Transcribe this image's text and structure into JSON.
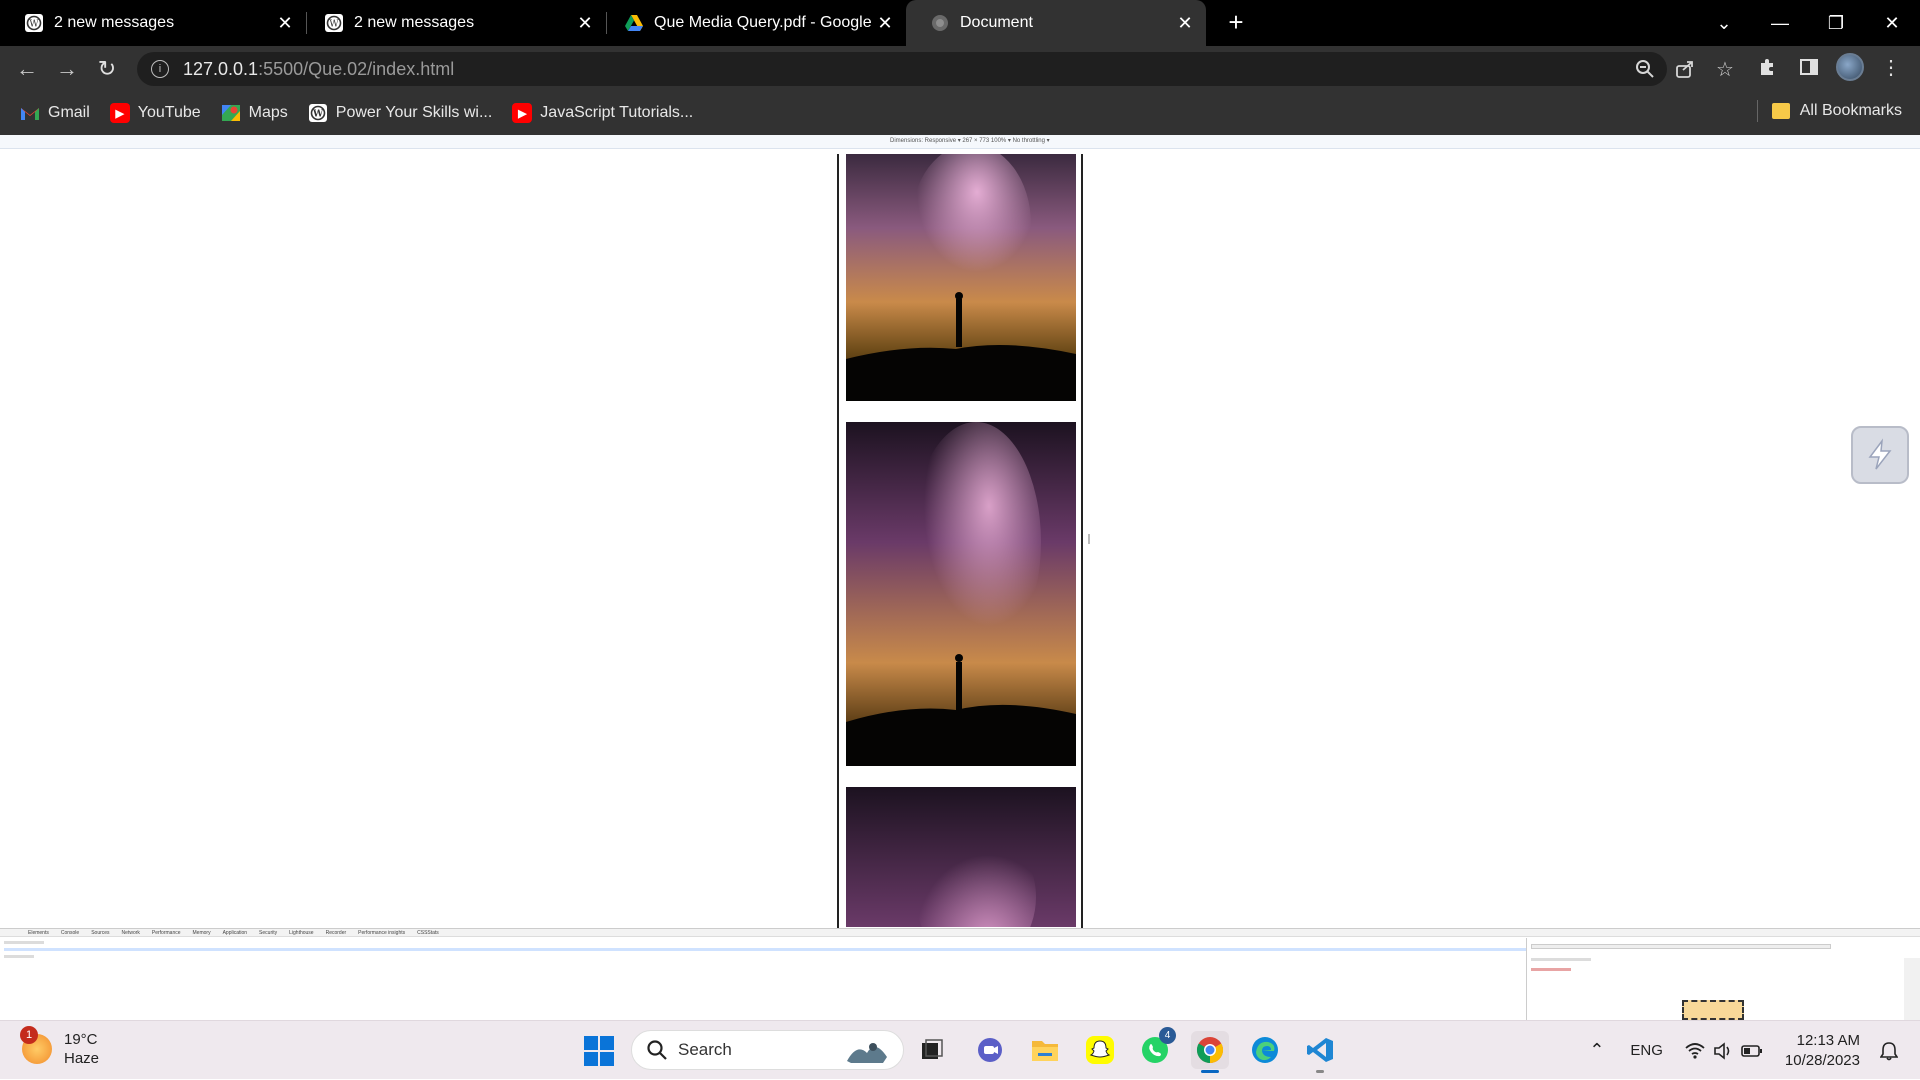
{
  "browser": {
    "tabs": [
      {
        "title": "2 new messages",
        "icon": "wordpress-icon",
        "active": false
      },
      {
        "title": "2 new messages",
        "icon": "wordpress-icon",
        "active": false
      },
      {
        "title": "Que Media Query.pdf - Google Drive",
        "icon": "google-drive-icon",
        "active": false
      },
      {
        "title": "Document",
        "icon": "globe-icon",
        "active": true
      }
    ],
    "new_tab_label": "+",
    "address": {
      "host": "127.0.0.1",
      "path": ":5500/Que.02/index.html"
    },
    "bookmarks": [
      {
        "label": "Gmail",
        "icon": "gmail-icon"
      },
      {
        "label": "YouTube",
        "icon": "youtube-icon"
      },
      {
        "label": "Maps",
        "icon": "maps-icon"
      },
      {
        "label": "Power Your Skills wi...",
        "icon": "wordpress-icon"
      },
      {
        "label": "JavaScript Tutorials...",
        "icon": "youtube-icon"
      }
    ],
    "all_bookmarks_label": "All Bookmarks"
  },
  "devtools": {
    "emulation_bar": "Dimensions: Responsive ▾   267  ×  773     100% ▾     No throttling ▾",
    "tabs": [
      "Elements",
      "Console",
      "Sources",
      "Network",
      "Performance",
      "Memory",
      "Application",
      "Security",
      "Lighthouse",
      "Recorder",
      "Performance insights",
      "CSSStats"
    ]
  },
  "page": {
    "images": [
      {
        "alt": "milky way with silhouette of person"
      },
      {
        "alt": "milky way with silhouette of person"
      },
      {
        "alt": "milky way with silhouette of person"
      }
    ]
  },
  "taskbar": {
    "weather": {
      "temp": "19°C",
      "condition": "Haze",
      "badge": "1"
    },
    "search_label": "Search",
    "apps": [
      {
        "name": "task-view-icon"
      },
      {
        "name": "teams-chat-icon"
      },
      {
        "name": "file-explorer-icon"
      },
      {
        "name": "snapchat-icon"
      },
      {
        "name": "whatsapp-icon",
        "badge": "4"
      },
      {
        "name": "chrome-icon"
      },
      {
        "name": "edge-icon"
      },
      {
        "name": "vscode-icon"
      }
    ],
    "language": "ENG",
    "time": "12:13 AM",
    "date": "10/28/2023"
  },
  "colors": {
    "tab_bar": "#000000",
    "toolbar": "#323232",
    "taskbar": "#efe9ee",
    "accent": "#0a67c2"
  }
}
